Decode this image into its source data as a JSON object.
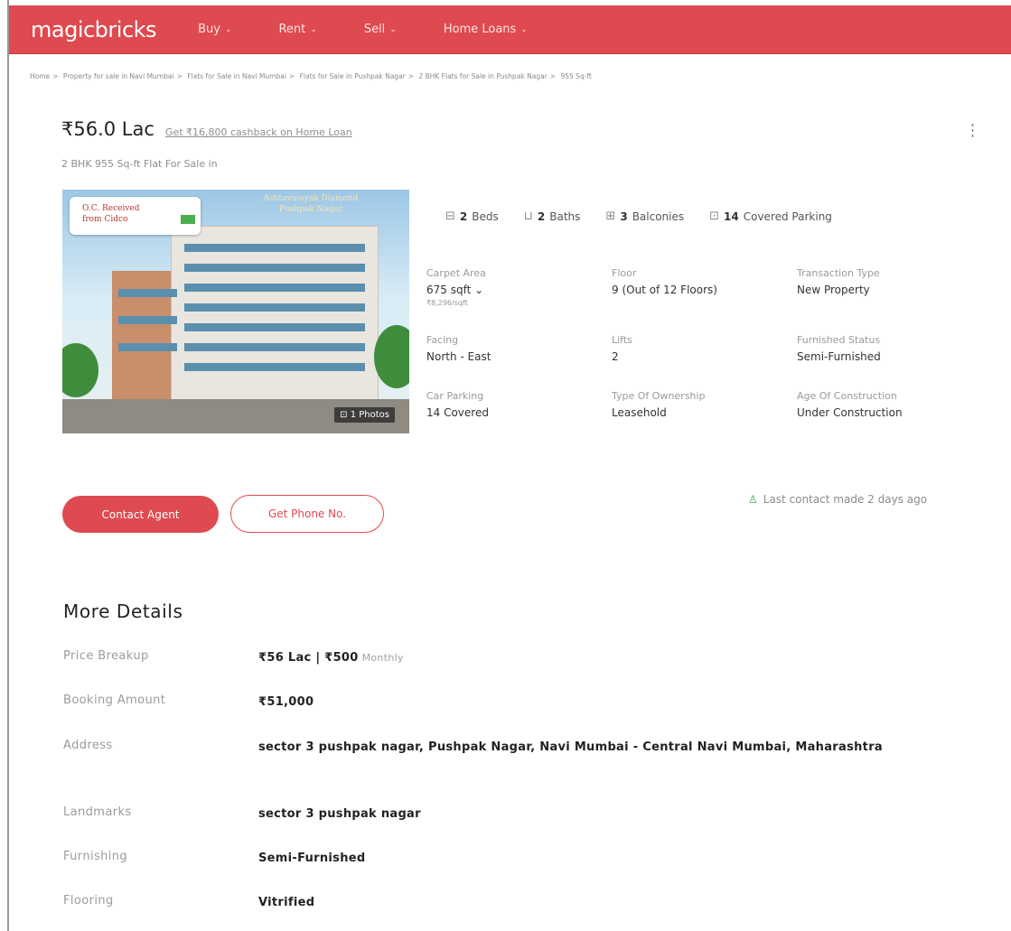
{
  "header": {
    "logo": "magicbricks",
    "nav": [
      {
        "label": "Buy"
      },
      {
        "label": "Rent"
      },
      {
        "label": "Sell"
      },
      {
        "label": "Home Loans"
      }
    ]
  },
  "breadcrumb": [
    "Home",
    "Property for sale in Navi Mumbai",
    "Flats for Sale in Navi Mumbai",
    "Flats for Sale in Pushpak Nagar",
    "2 BHK Flats for Sale in Pushpak Nagar",
    "955 Sq-ft"
  ],
  "listing": {
    "price": "₹56.0 Lac",
    "cashback": "Get ₹16,800 cashback on Home Loan",
    "subtitle": "2 BHK 955 Sq-ft Flat For Sale in",
    "photo": {
      "bubble_line1": "O.C. Received",
      "bubble_line2": "from Cidco",
      "banner_line1": "Ashtavinayak Diamond",
      "banner_line2": "Pushpak Nagar",
      "photos_badge": "1 Photos"
    },
    "amenities": [
      {
        "icon": "bed-icon",
        "glyph": "⊟",
        "count": "2",
        "label": "Beds"
      },
      {
        "icon": "bath-icon",
        "glyph": "⊔",
        "count": "2",
        "label": "Baths"
      },
      {
        "icon": "balcony-icon",
        "glyph": "⊞",
        "count": "3",
        "label": "Balconies"
      },
      {
        "icon": "parking-icon",
        "glyph": "⊡",
        "count": "14",
        "label": "Covered Parking"
      }
    ],
    "details": [
      {
        "label": "Carpet Area",
        "value": "675 sqft ⌄",
        "sub": "₹8,296/sqft"
      },
      {
        "label": "Floor",
        "value": "9 (Out of 12 Floors)",
        "sub": ""
      },
      {
        "label": "Transaction Type",
        "value": "New Property",
        "sub": ""
      },
      {
        "label": "Facing",
        "value": "North - East",
        "sub": ""
      },
      {
        "label": "Lifts",
        "value": "2",
        "sub": ""
      },
      {
        "label": "Furnished Status",
        "value": "Semi-Furnished",
        "sub": ""
      },
      {
        "label": "Car Parking",
        "value": "14 Covered",
        "sub": ""
      },
      {
        "label": "Type Of Ownership",
        "value": "Leasehold",
        "sub": ""
      },
      {
        "label": "Age Of Construction",
        "value": "Under Construction",
        "sub": ""
      }
    ],
    "contact_button": "Contact Agent",
    "phone_button": "Get Phone No.",
    "last_contact": "Last contact made 2 days ago"
  },
  "more_details": {
    "title": "More Details",
    "rows": [
      {
        "key": "Price Breakup",
        "value": "₹56 Lac | ₹500",
        "extra": "Monthly"
      },
      {
        "key": "Booking Amount",
        "value": "₹51,000",
        "extra": ""
      },
      {
        "key": "Address",
        "value": "sector 3 pushpak nagar, Pushpak Nagar, Navi Mumbai - Central Navi Mumbai, Maharashtra",
        "extra": ""
      },
      {
        "key": "Landmarks",
        "value": "sector 3 pushpak nagar",
        "extra": ""
      },
      {
        "key": "Furnishing",
        "value": "Semi-Furnished",
        "extra": ""
      },
      {
        "key": "Flooring",
        "value": "Vitrified",
        "extra": ""
      }
    ]
  },
  "colors": {
    "brand": "#de4a4f",
    "text": "#303030",
    "muted": "#9a9a9a",
    "success": "#43a047"
  }
}
